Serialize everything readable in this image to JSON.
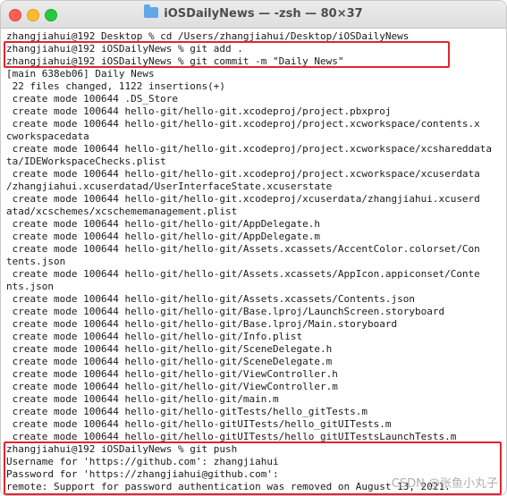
{
  "window": {
    "title": "iOSDailyNews — -zsh — 80×37"
  },
  "terminal": {
    "lines": [
      "zhangjiahui@192 Desktop % cd /Users/zhangjiahui/Desktop/iOSDailyNews",
      "zhangjiahui@192 iOSDailyNews % git add .",
      "zhangjiahui@192 iOSDailyNews % git commit -m \"Daily News\"",
      "[main 638eb06] Daily News",
      " 22 files changed, 1122 insertions(+)",
      " create mode 100644 .DS_Store",
      " create mode 100644 hello-git/hello-git.xcodeproj/project.pbxproj",
      " create mode 100644 hello-git/hello-git.xcodeproj/project.xcworkspace/contents.x",
      "cworkspacedata",
      " create mode 100644 hello-git/hello-git.xcodeproj/project.xcworkspace/xcshareddata",
      "ta/IDEWorkspaceChecks.plist",
      " create mode 100644 hello-git/hello-git.xcodeproj/project.xcworkspace/xcuserdata",
      "/zhangjiahui.xcuserdatad/UserInterfaceState.xcuserstate",
      " create mode 100644 hello-git/hello-git.xcodeproj/xcuserdata/zhangjiahui.xcuserd",
      "atad/xcschemes/xcschememanagement.plist",
      " create mode 100644 hello-git/hello-git/AppDelegate.h",
      " create mode 100644 hello-git/hello-git/AppDelegate.m",
      " create mode 100644 hello-git/hello-git/Assets.xcassets/AccentColor.colorset/Con",
      "tents.json",
      " create mode 100644 hello-git/hello-git/Assets.xcassets/AppIcon.appiconset/Conte",
      "nts.json",
      " create mode 100644 hello-git/hello-git/Assets.xcassets/Contents.json",
      " create mode 100644 hello-git/hello-git/Base.lproj/LaunchScreen.storyboard",
      " create mode 100644 hello-git/hello-git/Base.lproj/Main.storyboard",
      " create mode 100644 hello-git/hello-git/Info.plist",
      " create mode 100644 hello-git/hello-git/SceneDelegate.h",
      " create mode 100644 hello-git/hello-git/SceneDelegate.m",
      " create mode 100644 hello-git/hello-git/ViewController.h",
      " create mode 100644 hello-git/hello-git/ViewController.m",
      " create mode 100644 hello-git/hello-git/main.m",
      " create mode 100644 hello-git/hello-gitTests/hello_gitTests.m",
      " create mode 100644 hello-git/hello-gitUITests/hello_gitUITests.m",
      " create mode 100644 hello-git/hello-gitUITests/hello_gitUITestsLaunchTests.m",
      "zhangjiahui@192 iOSDailyNews % git push",
      "Username for 'https://github.com': zhangjiahui",
      "Password for 'https://zhangjiahui@github.com':",
      "remote: Support for password authentication was removed on August 13, 2021."
    ]
  },
  "watermark": "CSDN @张鱼小丸子",
  "colors": {
    "highlight": "#e0262e",
    "text": "#1a1a1a"
  },
  "icons": {
    "title": "folder-icon"
  }
}
